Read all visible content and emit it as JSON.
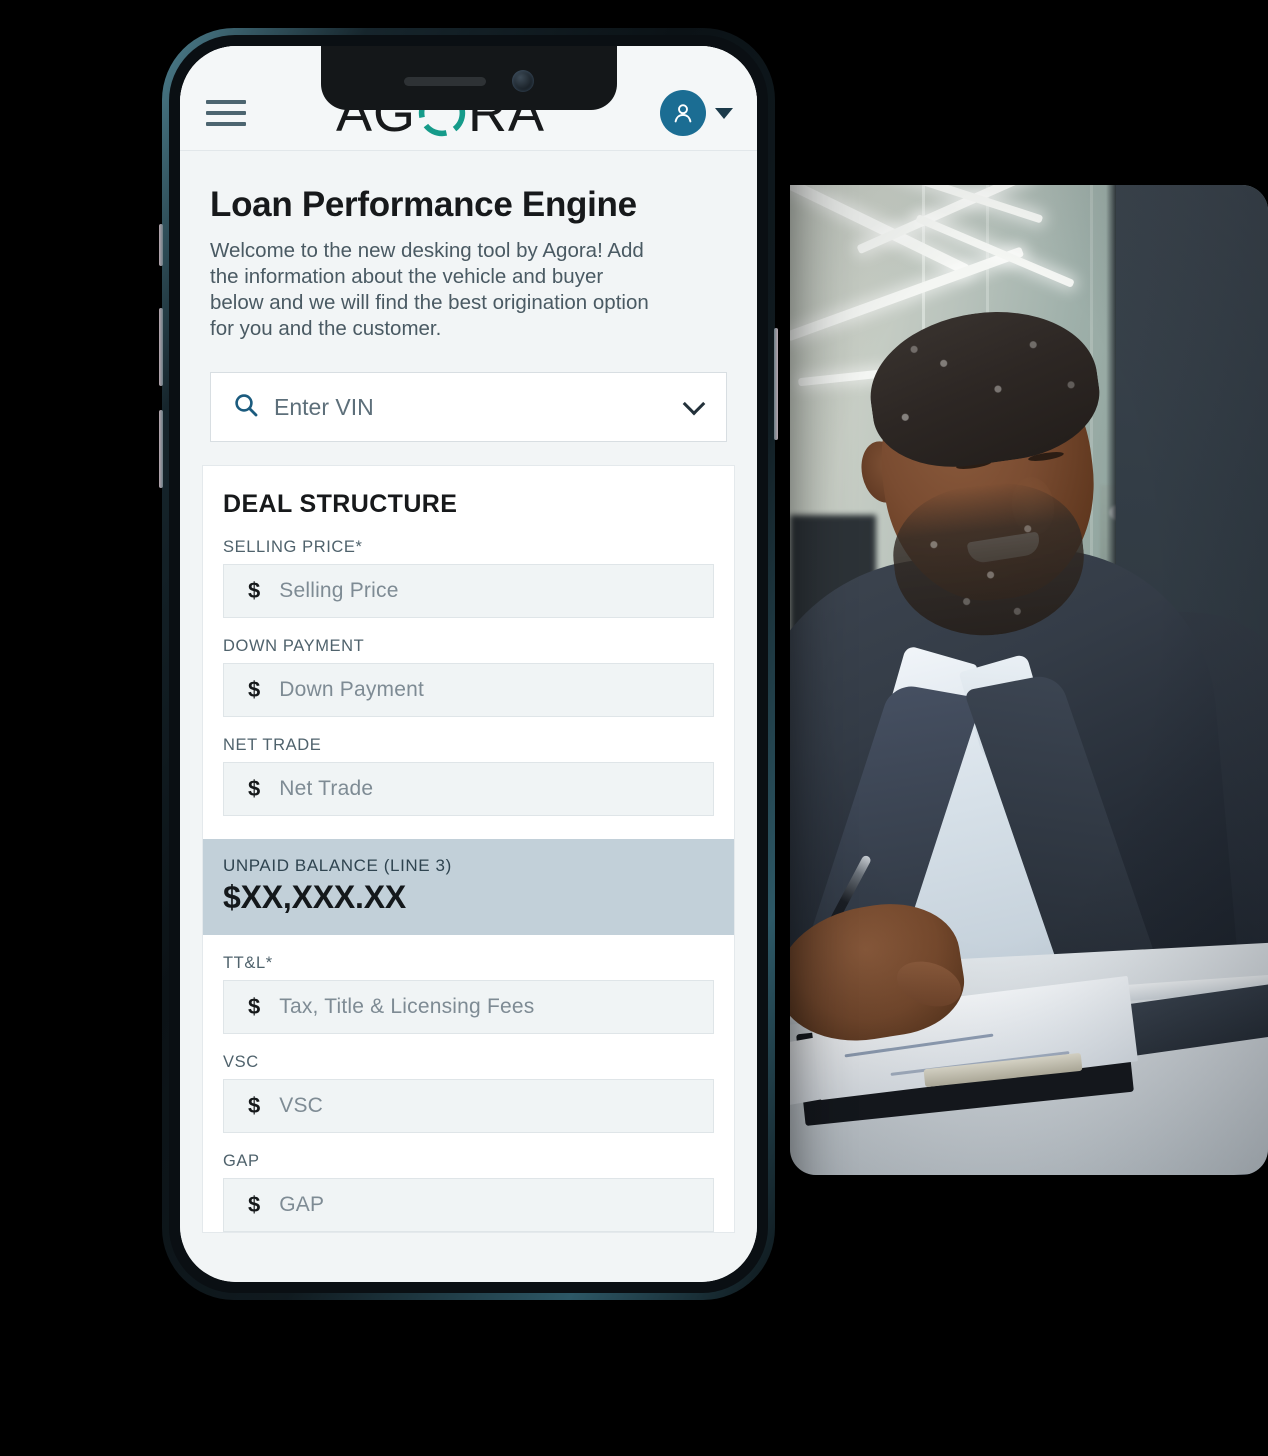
{
  "header": {
    "menu_icon": "hamburger-icon",
    "logo": {
      "before": "AG",
      "ring": "O",
      "after": "RA",
      "trademark": "™",
      "ring_color": "#159b8a"
    },
    "avatar_icon": "person-icon",
    "avatar_color": "#1b6d93",
    "caret_icon": "caret-down-icon"
  },
  "page": {
    "title": "Loan Performance Engine",
    "description": "Welcome to the new desking tool by Agora! Add the information about the vehicle and buyer below and we will find the best origination option for you and the customer."
  },
  "vin_search": {
    "search_icon": "search-icon",
    "placeholder": "Enter VIN",
    "value": "",
    "chevron_icon": "chevron-down-icon"
  },
  "deal_structure": {
    "title": "DEAL STRUCTURE",
    "currency_symbol": "$",
    "fields": [
      {
        "label": "SELLING PRICE*",
        "placeholder": "Selling Price",
        "value": ""
      },
      {
        "label": "DOWN PAYMENT",
        "placeholder": "Down Payment",
        "value": ""
      },
      {
        "label": "NET TRADE",
        "placeholder": "Net Trade",
        "value": ""
      }
    ],
    "balance": {
      "label": "UNPAID BALANCE (LINE 3)",
      "value": "$XX,XXX.XX",
      "background": "#c2d0d9"
    },
    "fields_after": [
      {
        "label": "TT&L*",
        "placeholder": "Tax, Title & Licensing Fees",
        "value": ""
      },
      {
        "label": "VSC",
        "placeholder": "VSC",
        "value": ""
      },
      {
        "label": "GAP",
        "placeholder": "GAP",
        "value": ""
      }
    ]
  },
  "photo": {
    "alt": "Smiling businessman at a desk writing on documents on a clipboard"
  }
}
